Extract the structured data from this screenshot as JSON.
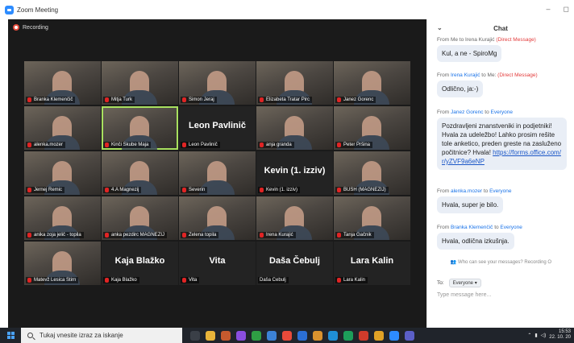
{
  "window": {
    "title": "Zoom Meeting",
    "minimize": "–",
    "maximize": "◻"
  },
  "recording": {
    "label": "Recording"
  },
  "tiles": [
    {
      "name": "Branka Klemenčič",
      "type": "photo"
    },
    {
      "name": "Mitja Turk",
      "type": "photo"
    },
    {
      "name": "Simon Jeraj",
      "type": "photo"
    },
    {
      "name": "Elizabeta Tratar Pirc",
      "type": "photo"
    },
    {
      "name": "Janez Gorenc",
      "type": "photo"
    },
    {
      "name": "alenka.mozer",
      "type": "photo"
    },
    {
      "name": "Kinči Skube Maja",
      "type": "photo",
      "active": true
    },
    {
      "name": "Leon Pavlinič",
      "type": "name",
      "big": "Leon Pavlinič"
    },
    {
      "name": "anja granda",
      "type": "photo"
    },
    {
      "name": "Peter Pršina",
      "type": "photo"
    },
    {
      "name": "Jernej Remic",
      "type": "photo"
    },
    {
      "name": "4.A Magnezij",
      "type": "photo"
    },
    {
      "name": "Severin",
      "type": "photo"
    },
    {
      "name": "Kevin (1. izziv)",
      "type": "name",
      "big": "Kevin (1. izziv)"
    },
    {
      "name": "BUSH (MAGNEZIJ)",
      "type": "photo"
    },
    {
      "name": "anika zoja jelič - topila",
      "type": "photo"
    },
    {
      "name": "anka pezdirc MAGNEZIJ",
      "type": "photo"
    },
    {
      "name": "Zelena topila",
      "type": "photo"
    },
    {
      "name": "Irena Kurajić",
      "type": "photo"
    },
    {
      "name": "Tanja Gačnik",
      "type": "photo"
    },
    {
      "name": "Matevž Lesica Štirn",
      "type": "photo"
    },
    {
      "name": "Kaja Blažko",
      "type": "name",
      "big": "Kaja Blažko"
    },
    {
      "name": "Vita",
      "type": "name",
      "big": "Vita"
    },
    {
      "name": "Daša Čebulj",
      "type": "name",
      "big": "Daša Čebulj",
      "nomic": true
    },
    {
      "name": "Lara Kalin",
      "type": "name",
      "big": "Lara Kalin"
    }
  ],
  "chat": {
    "title": "Chat",
    "messages": [
      {
        "from": "From Me to",
        "sender": "",
        "to": "Irena Kurajić",
        "dm": "(Direct Message)",
        "text": "Kul, a ne - SpiroMg"
      },
      {
        "from": "From",
        "sender": "Irena Kurajić",
        "to": "to Me:",
        "dm": "(Direct Message)",
        "text": "Odlično, ja:-)"
      },
      {
        "from": "From",
        "sender": "Janez Gorenc",
        "to": "to",
        "recipient": "Everyone",
        "text": "Pozdravljeni znanstveniki in podjetniki! Hvala za udeležbo! Lahko prosim rešite tole anketico, preden greste na zasluženo počitnice? Hvala!",
        "link": "https://forms.office.com/r/yZVF9a6eNP"
      },
      {
        "from": "From",
        "sender": "alenka.mozer",
        "to": "to",
        "recipient": "Everyone",
        "text": "Hvala, super je bilo."
      },
      {
        "from": "From",
        "sender": "Branka Klemenčič",
        "to": "to",
        "recipient": "Everyone",
        "text": "Hvala, odlična izkušnja."
      }
    ],
    "who_can_see": "Who can see your messages? Recording O",
    "to_label": "To:",
    "to_value": "Everyone",
    "input_placeholder": "Type message here..."
  },
  "taskbar": {
    "search_placeholder": "Tukaj vnesite izraz za iskanje",
    "time": "15:53",
    "date": "22. 10. 20"
  }
}
